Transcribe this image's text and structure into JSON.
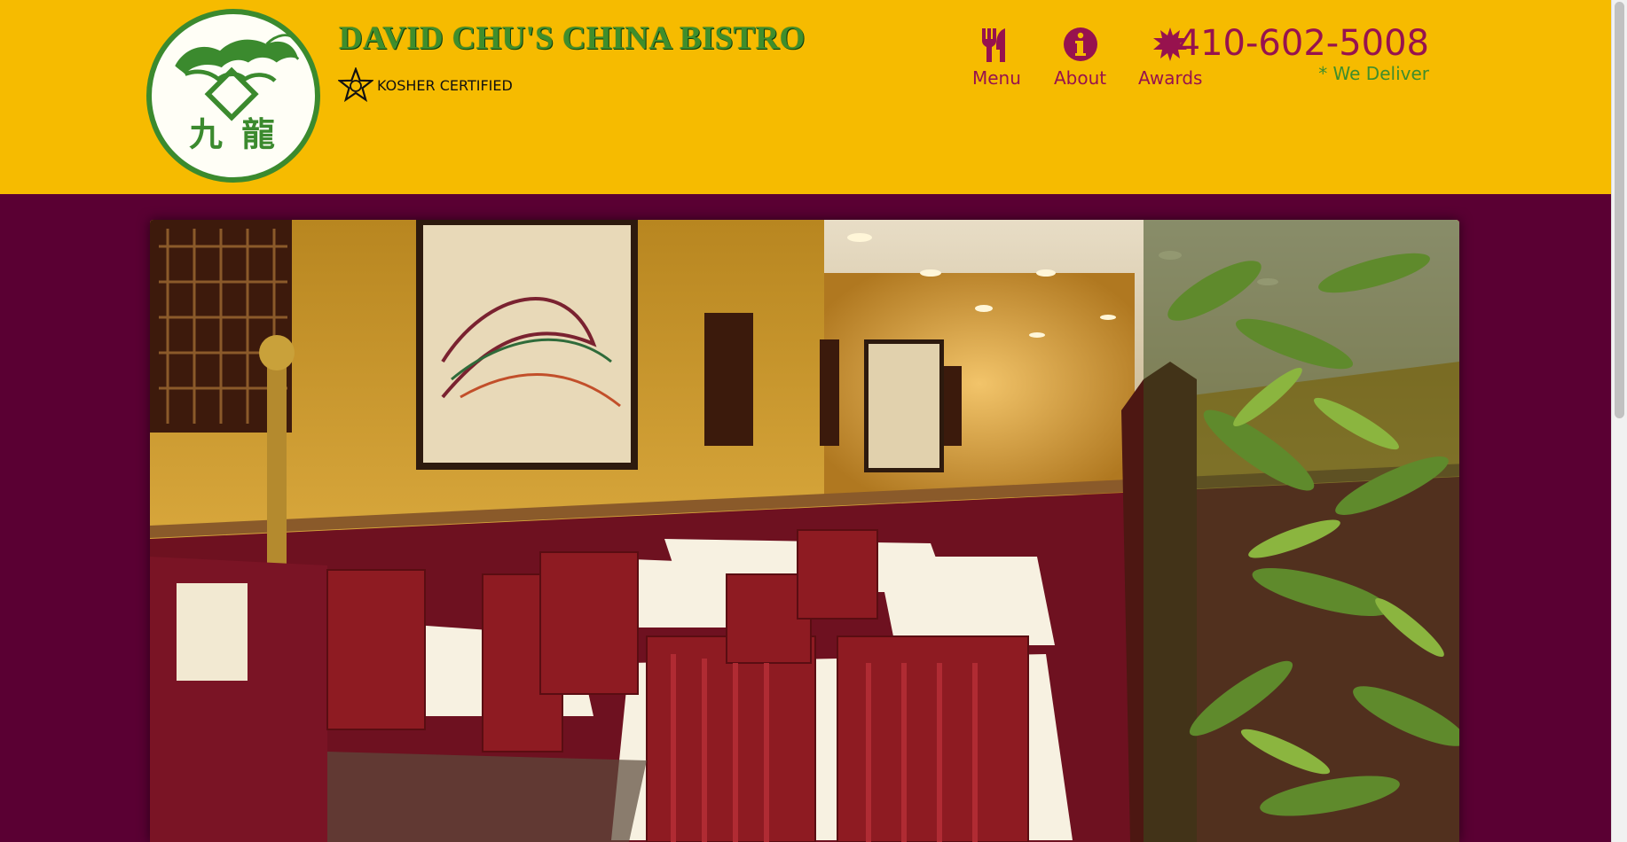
{
  "brand": {
    "title": "DAVID CHU'S CHINA BISTRO",
    "kosher_label": "KOSHER CERTIFIED",
    "logo_glyphs": "九 龍"
  },
  "nav": {
    "items": [
      {
        "label": "Menu",
        "icon": "utensils-icon"
      },
      {
        "label": "About",
        "icon": "info-icon"
      },
      {
        "label": "Awards",
        "icon": "award-burst-icon"
      }
    ]
  },
  "contact": {
    "phone": "410-602-5008",
    "note": "* We Deliver"
  },
  "colors": {
    "header_bg": "#f6bb00",
    "page_bg": "#5a0033",
    "accent_maroon": "#97124e",
    "brand_green": "#3f8e2c"
  },
  "hero": {
    "subject": "restaurant-dining-room-photo"
  }
}
